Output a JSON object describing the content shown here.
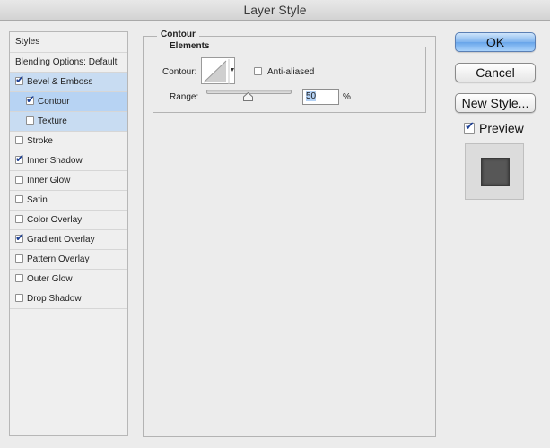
{
  "window": {
    "title": "Layer Style"
  },
  "sidebar": {
    "header": "Styles",
    "blending": "Blending Options: Default",
    "items": [
      {
        "label": "Bevel & Emboss",
        "checked": true
      },
      {
        "label": "Contour",
        "checked": true
      },
      {
        "label": "Texture",
        "checked": false
      },
      {
        "label": "Stroke",
        "checked": false
      },
      {
        "label": "Inner Shadow",
        "checked": true
      },
      {
        "label": "Inner Glow",
        "checked": false
      },
      {
        "label": "Satin",
        "checked": false
      },
      {
        "label": "Color Overlay",
        "checked": false
      },
      {
        "label": "Gradient Overlay",
        "checked": true
      },
      {
        "label": "Pattern Overlay",
        "checked": false
      },
      {
        "label": "Outer Glow",
        "checked": false
      },
      {
        "label": "Drop Shadow",
        "checked": false
      }
    ]
  },
  "panel": {
    "title": "Contour",
    "group_title": "Elements",
    "contour_label": "Contour:",
    "antialiased_label": "Anti-aliased",
    "antialiased_checked": false,
    "range_label": "Range:",
    "range_value": "50",
    "range_unit": "%"
  },
  "buttons": {
    "ok": "OK",
    "cancel": "Cancel",
    "new_style": "New Style..."
  },
  "preview": {
    "label": "Preview",
    "checked": true
  }
}
